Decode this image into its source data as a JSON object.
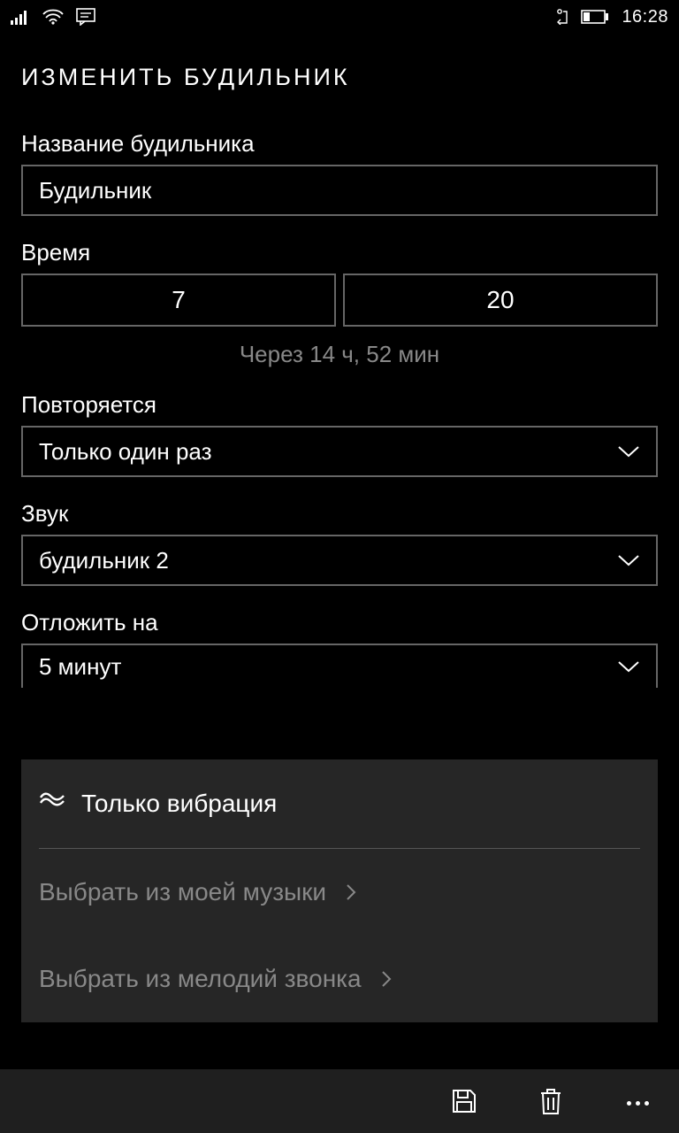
{
  "status": {
    "time": "16:28"
  },
  "page": {
    "title": "ИЗМЕНИТЬ БУДИЛЬНИК"
  },
  "name": {
    "label": "Название будильника",
    "value": "Будильник"
  },
  "time": {
    "label": "Время",
    "hour": "7",
    "minute": "20",
    "remaining": "Через 14 ч, 52 мин"
  },
  "repeat": {
    "label": "Повторяется",
    "value": "Только один раз"
  },
  "sound": {
    "label": "Звук",
    "value": "будильник 2"
  },
  "snooze": {
    "label": "Отложить на",
    "value": "5 минут"
  },
  "popup": {
    "vibrate_only": "Только вибрация",
    "from_music": "Выбрать из моей музыки",
    "from_ringtones": "Выбрать из мелодий звонка"
  }
}
